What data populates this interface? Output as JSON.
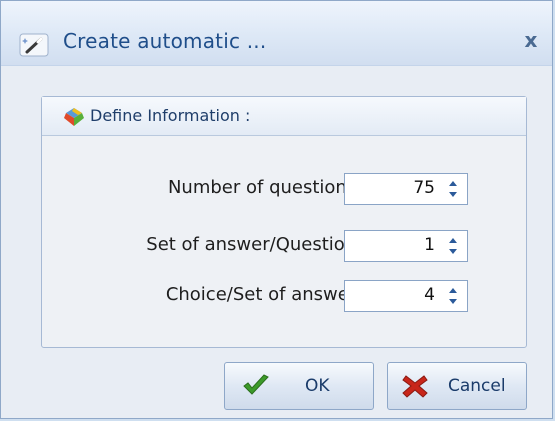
{
  "window": {
    "title": "Create automatic ...",
    "close_symbol": "x",
    "icon": "wizard-wand-icon"
  },
  "group": {
    "title": "Define Information :",
    "icon": "colorful-diamond-icon"
  },
  "fields": [
    {
      "label": "Number of questions :",
      "value": "75"
    },
    {
      "label": "Set of answer/Question :",
      "value": "1"
    },
    {
      "label": "Choice/Set of answer :",
      "value": "4"
    }
  ],
  "buttons": {
    "ok_label": "OK",
    "ok_icon": "green-check-icon",
    "cancel_label": "Cancel",
    "cancel_icon": "red-cross-icon"
  },
  "colors": {
    "title_text": "#1f4e8a",
    "check_green": "#3c9a2a",
    "cross_red": "#c8261a"
  }
}
